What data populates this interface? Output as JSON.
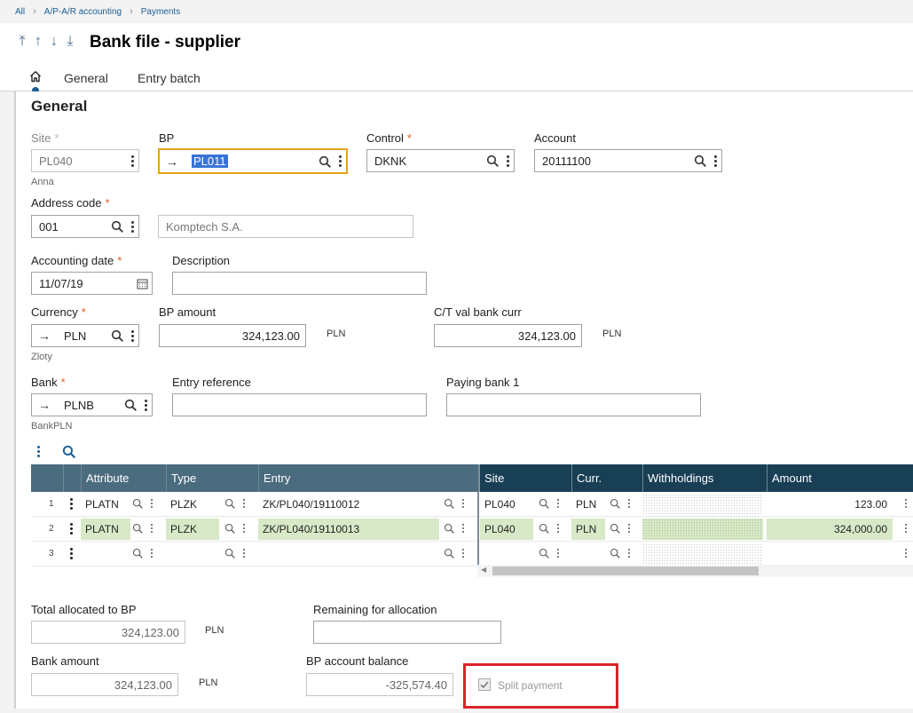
{
  "breadcrumb": {
    "items": [
      "All",
      "A/P-A/R accounting",
      "Payments"
    ]
  },
  "header": {
    "title": "Bank file - supplier",
    "tabs": [
      "General",
      "Entry batch"
    ]
  },
  "section": {
    "title": "General"
  },
  "form": {
    "site": {
      "label": "Site",
      "value": "PL040",
      "sub": "Anna"
    },
    "bp": {
      "label": "BP",
      "value": "PL011"
    },
    "control": {
      "label": "Control",
      "value": "DKNK"
    },
    "account": {
      "label": "Account",
      "value": "20111100"
    },
    "address_code": {
      "label": "Address code",
      "value": "001",
      "desc": "Komptech S.A."
    },
    "accounting_date": {
      "label": "Accounting date",
      "value": "11/07/19"
    },
    "description": {
      "label": "Description",
      "value": ""
    },
    "currency": {
      "label": "Currency",
      "value": "PLN",
      "sub": "Zloty"
    },
    "bp_amount": {
      "label": "BP amount",
      "value": "324,123.00",
      "unit": "PLN"
    },
    "ct_val": {
      "label": "C/T val bank curr",
      "value": "324,123.00",
      "unit": "PLN"
    },
    "bank": {
      "label": "Bank",
      "value": "PLNB",
      "sub": "BankPLN"
    },
    "entry_reference": {
      "label": "Entry reference",
      "value": ""
    },
    "paying_bank": {
      "label": "Paying bank 1",
      "value": ""
    }
  },
  "grid": {
    "columns": [
      "Attribute",
      "Type",
      "Entry",
      "Site",
      "Curr.",
      "Withholdings",
      "Amount"
    ],
    "rows": [
      {
        "num": "1",
        "attribute": "PLATN",
        "type": "PLZK",
        "entry": "ZK/PL040/19110012",
        "site": "PL040",
        "curr": "PLN",
        "amount": "123.00"
      },
      {
        "num": "2",
        "attribute": "PLATN",
        "type": "PLZK",
        "entry": "ZK/PL040/19110013",
        "site": "PL040",
        "curr": "PLN",
        "amount": "324,000.00"
      },
      {
        "num": "3",
        "attribute": "",
        "type": "",
        "entry": "",
        "site": "",
        "curr": "",
        "amount": ""
      }
    ]
  },
  "totals": {
    "total_allocated": {
      "label": "Total allocated to BP",
      "value": "324,123.00",
      "unit": "PLN"
    },
    "remaining": {
      "label": "Remaining for allocation",
      "value": ""
    },
    "bank_amount": {
      "label": "Bank amount",
      "value": "324,123.00",
      "unit": "PLN"
    },
    "bp_balance": {
      "label": "BP account balance",
      "value": "-325,574.40"
    },
    "split_payment": {
      "label": "Split payment",
      "checked": true
    }
  },
  "colors": {
    "accent": "#1a5f96",
    "grid_header": "#4b6b7e",
    "grid_header_dark": "#193f55",
    "required": "#e85d22",
    "highlight": "#d8e9c7",
    "callout": "#d9232a"
  },
  "icons": [
    "arrow-first-icon",
    "arrow-up-icon",
    "arrow-down-icon",
    "arrow-last-icon",
    "home-icon",
    "search-icon",
    "more-icon",
    "calendar-icon",
    "arrow-right-icon",
    "checkbox-icon"
  ]
}
